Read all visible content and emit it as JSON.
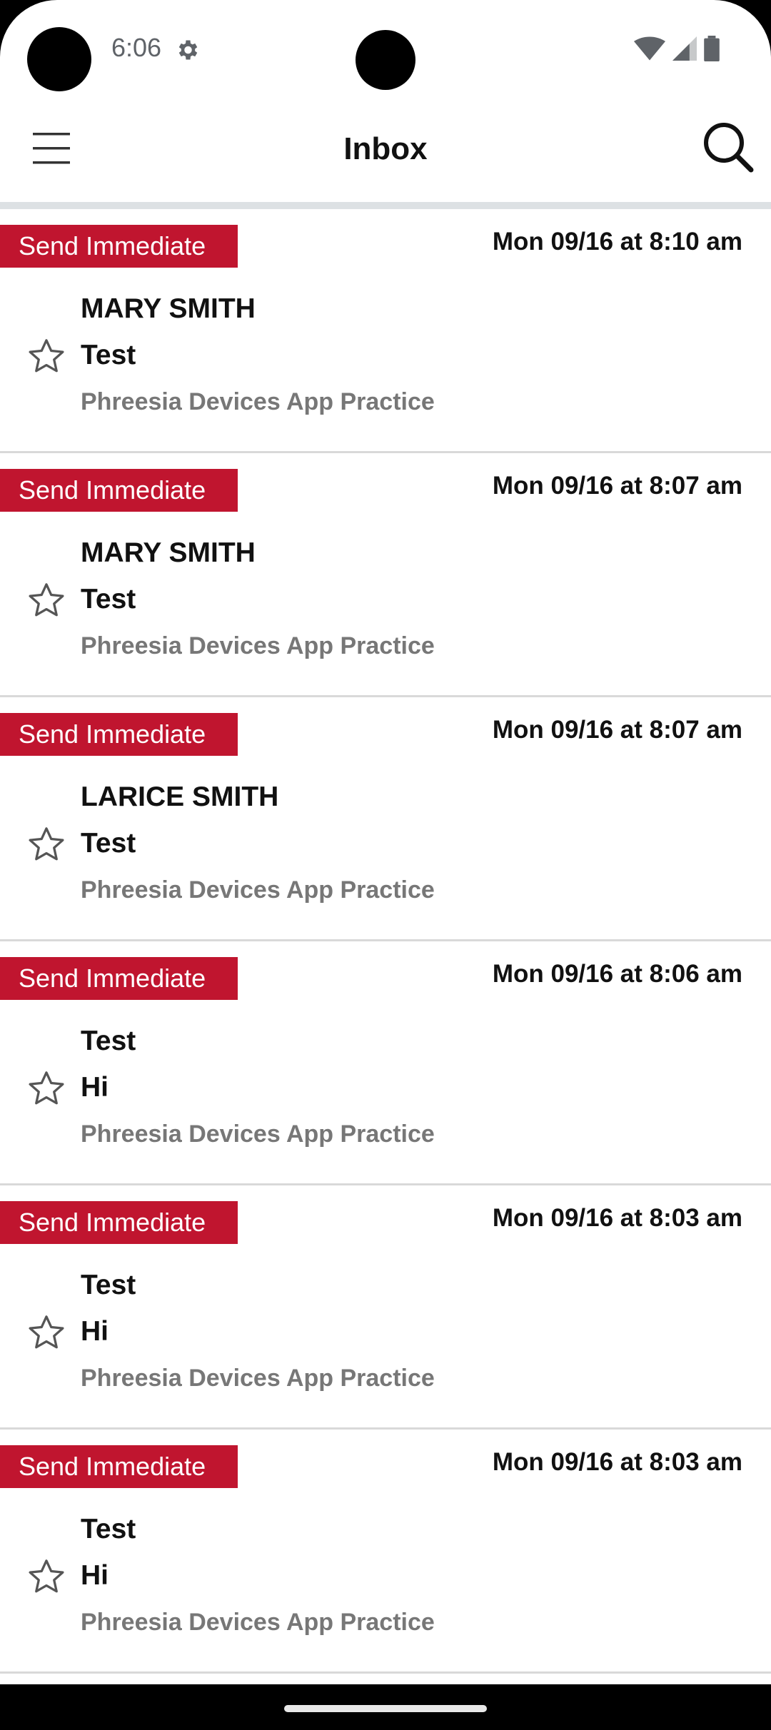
{
  "status_bar": {
    "time": "6:06",
    "icons": [
      "settings-icon",
      "wifi-icon",
      "signal-icon",
      "battery-icon"
    ]
  },
  "app_bar": {
    "title": "Inbox",
    "menu_icon": "hamburger-menu-icon",
    "search_icon": "search-icon"
  },
  "colors": {
    "badge": "#c0152f",
    "divider": "#d9d9d9",
    "secondary_text": "#777777"
  },
  "messages": [
    {
      "badge": "Send Immediate",
      "date": "Mon 09/16 at 8:10 am",
      "sender": "MARY SMITH",
      "subject": "Test",
      "practice": "Phreesia Devices App Practice",
      "starred": false
    },
    {
      "badge": "Send Immediate",
      "date": "Mon 09/16 at 8:07 am",
      "sender": "MARY SMITH",
      "subject": "Test",
      "practice": "Phreesia Devices App Practice",
      "starred": false
    },
    {
      "badge": "Send Immediate",
      "date": "Mon 09/16 at 8:07 am",
      "sender": "LARICE SMITH",
      "subject": "Test",
      "practice": "Phreesia Devices App Practice",
      "starred": false
    },
    {
      "badge": "Send Immediate",
      "date": "Mon 09/16 at 8:06 am",
      "sender": "Test",
      "subject": "Hi",
      "practice": "Phreesia Devices App Practice",
      "starred": false
    },
    {
      "badge": "Send Immediate",
      "date": "Mon 09/16 at 8:03 am",
      "sender": "Test",
      "subject": "Hi",
      "practice": "Phreesia Devices App Practice",
      "starred": false
    },
    {
      "badge": "Send Immediate",
      "date": "Mon 09/16 at 8:03 am",
      "sender": "Test",
      "subject": "Hi",
      "practice": "Phreesia Devices App Practice",
      "starred": false
    }
  ]
}
